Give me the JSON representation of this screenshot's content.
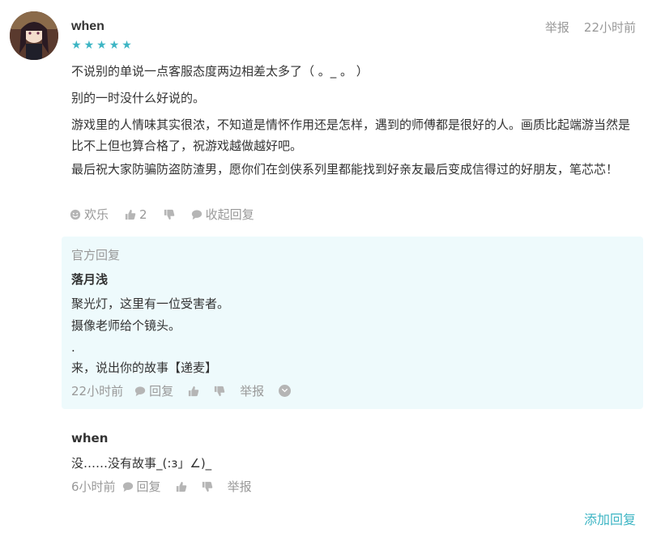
{
  "comment": {
    "username": "when",
    "rating": 5,
    "stars": [
      "★",
      "★",
      "★",
      "★",
      "★"
    ],
    "report_label": "举报",
    "time": "22小时前",
    "paragraphs": [
      "不说别的单说一点客服态度两边相差太多了（ 。_ 。 ）",
      "别的一时没什么好说的。",
      "游戏里的人情味其实很浓，不知道是情怀作用还是怎样，遇到的师傅都是很好的人。画质比起端游当然是比不上但也算合格了，祝游戏越做越好吧。",
      "最后祝大家防骗防盗防渣男，愿你们在剑侠系列里都能找到好亲友最后变成信得过的好朋友，笔芯芯！"
    ],
    "actions": {
      "mood_label": "欢乐",
      "like_count": "2",
      "collapse_label": "收起回复"
    }
  },
  "official_reply": {
    "header": "官方回复",
    "name": "落月浅",
    "lines": [
      "聚光灯，这里有一位受害者。",
      "摄像老师给个镜头。",
      ".",
      "来，说出你的故事【递麦】"
    ],
    "time": "22小时前",
    "reply_label": "回复",
    "report_label": "举报"
  },
  "sub_reply": {
    "name": "when",
    "text": "没……没有故事_(:з」∠)_",
    "time": "6小时前",
    "reply_label": "回复",
    "report_label": "举报"
  },
  "add_reply_label": "添加回复",
  "colors": {
    "accent": "#3db5c4",
    "muted": "#999999",
    "reply_bg": "#eefafc"
  },
  "icons": [
    "smiley-icon",
    "thumbs-up-icon",
    "thumbs-down-icon",
    "comment-icon",
    "chevron-down-icon"
  ]
}
